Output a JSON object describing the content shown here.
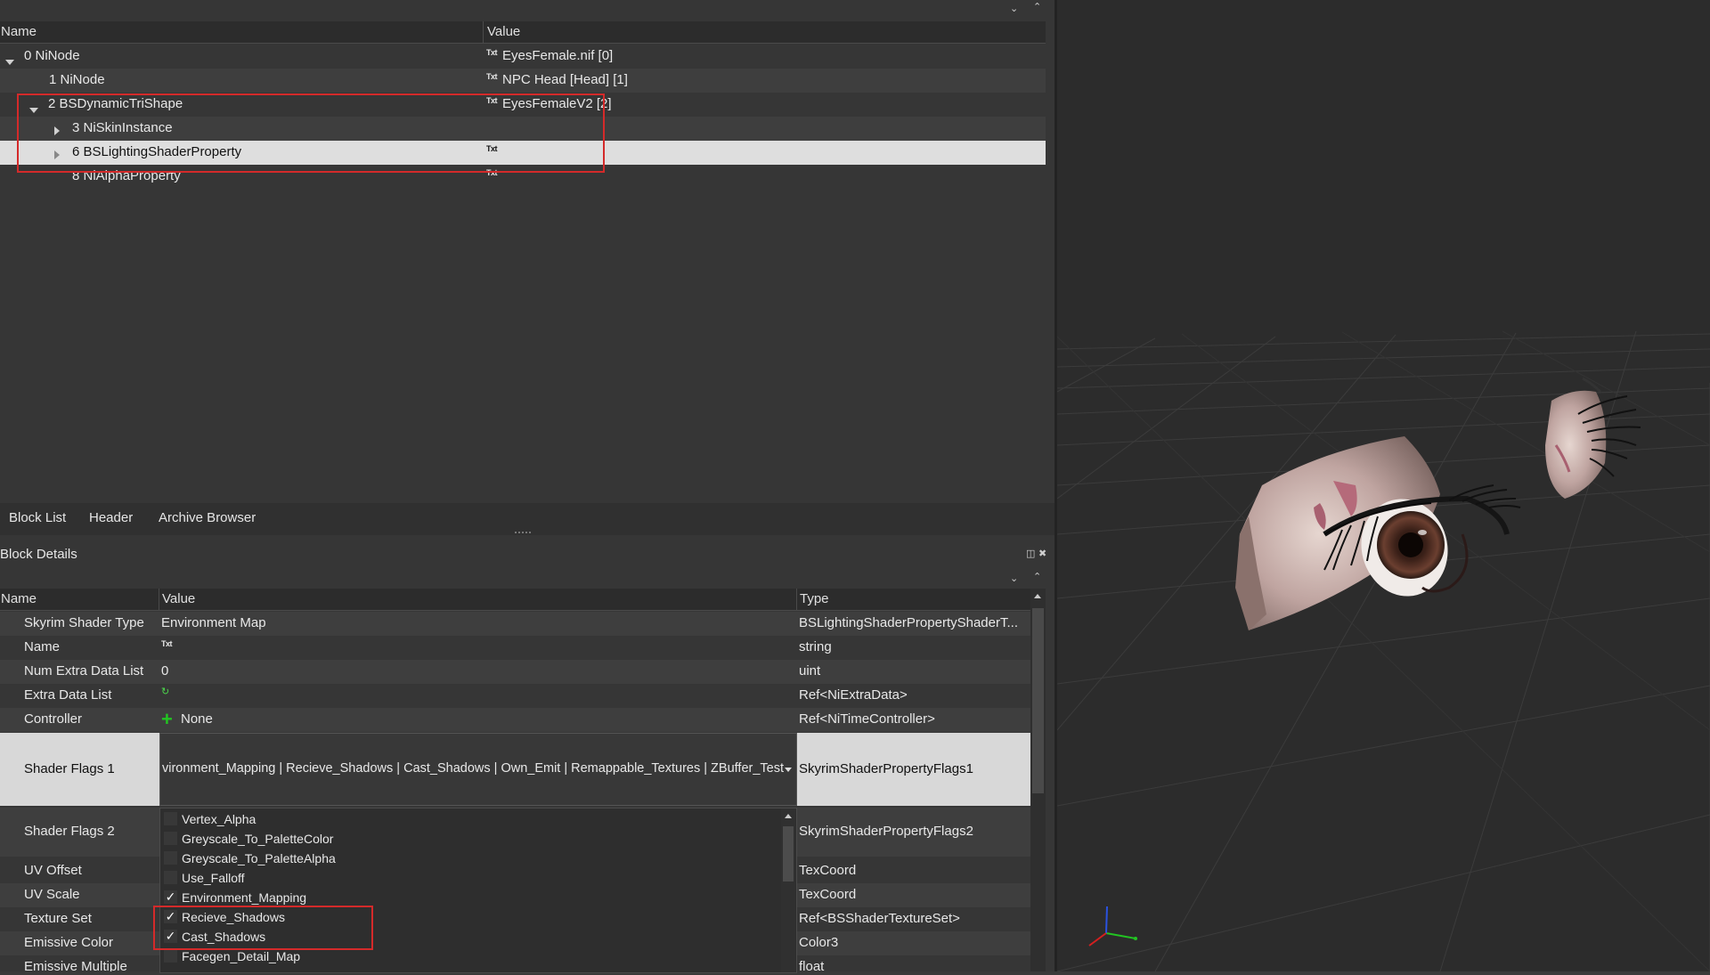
{
  "tree": {
    "columns": [
      "Name",
      "Value"
    ],
    "rows": [
      {
        "name": "0 NiNode",
        "value": "EyesFemale.nif [0]",
        "expander": "down",
        "has_txt": true
      },
      {
        "name": "1 NiNode",
        "value": "NPC Head [Head] [1]",
        "expander": "",
        "has_txt": true
      },
      {
        "name": "2 BSDynamicTriShape",
        "value": "EyesFemaleV2 [2]",
        "expander": "down",
        "has_txt": true
      },
      {
        "name": "3 NiSkinInstance",
        "value": "",
        "expander": "right",
        "has_txt": false
      },
      {
        "name": "6 BSLightingShaderProperty",
        "value": "",
        "expander": "right",
        "has_txt": true,
        "selected": true
      },
      {
        "name": "8 NiAlphaProperty",
        "value": "",
        "expander": "",
        "has_txt": true
      }
    ],
    "txt_icon": "Txt"
  },
  "tabs": [
    "Block List",
    "Header",
    "Archive Browser"
  ],
  "details": {
    "title": "Block Details",
    "columns": [
      "Name",
      "Value",
      "Type"
    ],
    "rows": [
      {
        "name": "Skyrim Shader Type",
        "value": "Environment Map",
        "type": "BSLightingShaderPropertyShaderT..."
      },
      {
        "name": "Name",
        "value": "",
        "type": "string"
      },
      {
        "name": "Num Extra Data List",
        "value": "0",
        "type": "uint"
      },
      {
        "name": "Extra Data List",
        "value": "",
        "type": "Ref<NiExtraData>"
      },
      {
        "name": "Controller",
        "value": "None",
        "type": "Ref<NiTimeController>"
      },
      {
        "name": "Shader Flags 1",
        "value": "vironment_Mapping | Recieve_Shadows | Cast_Shadows | Own_Emit | Remappable_Textures | ZBuffer_Test",
        "type": "SkyrimShaderPropertyFlags1"
      },
      {
        "name": "Shader Flags 2",
        "value": "",
        "type": "SkyrimShaderPropertyFlags2"
      },
      {
        "name": "UV Offset",
        "value": "",
        "type": "TexCoord"
      },
      {
        "name": "UV Scale",
        "value": "",
        "type": "TexCoord"
      },
      {
        "name": "Texture Set",
        "value": "",
        "type": "Ref<BSShaderTextureSet>"
      },
      {
        "name": "Emissive Color",
        "value": "",
        "type": "Color3"
      },
      {
        "name": "Emissive Multiple",
        "value": "",
        "type": "float"
      }
    ],
    "flags_dropdown": [
      {
        "label": "Vertex_Alpha",
        "checked": false
      },
      {
        "label": "Greyscale_To_PaletteColor",
        "checked": false
      },
      {
        "label": "Greyscale_To_PaletteAlpha",
        "checked": false
      },
      {
        "label": "Use_Falloff",
        "checked": false
      },
      {
        "label": "Environment_Mapping",
        "checked": true
      },
      {
        "label": "Recieve_Shadows",
        "checked": true
      },
      {
        "label": "Cast_Shadows",
        "checked": true
      },
      {
        "label": "Facegen_Detail_Map",
        "checked": false
      }
    ]
  },
  "colors": {
    "highlight_box": "#d42a2a",
    "selected_row": "#dedede",
    "viewport_bg": "#2c2c2c"
  }
}
